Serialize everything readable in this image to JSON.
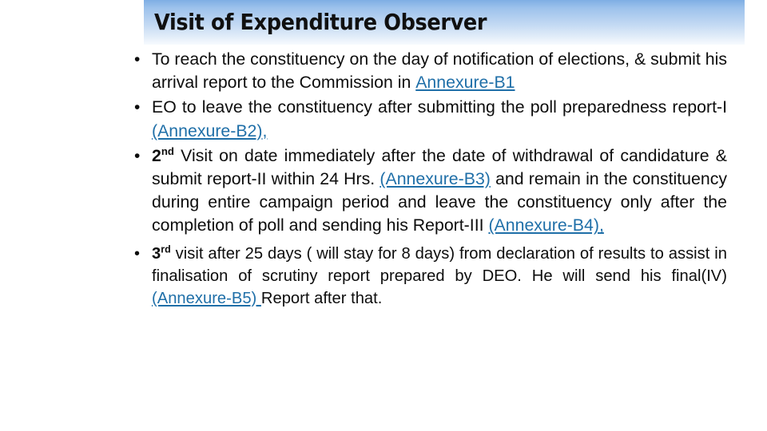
{
  "slide": {
    "title": "Visit of Expenditure Observer",
    "accent_color": "#1F6FA8",
    "title_band_top_color": "#7FAEE4",
    "title_band_bottom_color": "#F7FAFE",
    "text_color": "#0D0D0D",
    "bullet_glyph": "•"
  },
  "bullets": [
    {
      "id": "bullet-1",
      "marker": "•",
      "segments": [
        {
          "kind": "text",
          "value": "To reach the constituency on the day of notification of elections, & submit his arrival report to the Commission in "
        },
        {
          "kind": "link",
          "value": "Annexure-B1"
        }
      ],
      "plain": "To reach the constituency on the day of notification of elections, & submit his arrival report to the Commission in Annexure-B1"
    },
    {
      "id": "bullet-2",
      "marker": "•",
      "segments": [
        {
          "kind": "text",
          "value": "EO to leave the constituency after submitting the poll preparedness report-I "
        },
        {
          "kind": "link",
          "value": "(Annexure-B2),"
        }
      ],
      "plain": "EO to leave the constituency after submitting the poll preparedness report-I (Annexure-B2),"
    },
    {
      "id": "bullet-3",
      "marker": "•",
      "ordinal_number": "2",
      "ordinal_suffix": "nd",
      "segments": [
        {
          "kind": "ordinal",
          "value": "2",
          "suffix": "nd"
        },
        {
          "kind": "text",
          "value": " Visit on date immediately after the date of withdrawal of candidature & submit report-II within 24 Hrs. "
        },
        {
          "kind": "link",
          "value": "(Annexure-B3)"
        },
        {
          "kind": "text",
          "value": " and remain in the constituency during entire campaign period and leave the constituency only after the completion of poll and sending  his Report-III "
        },
        {
          "kind": "link",
          "value": "(Annexure-B4),"
        }
      ],
      "plain": "2nd Visit on date immediately after the date of withdrawal of candidature & submit report-II within 24 Hrs. (Annexure-B3) and remain in the constituency during entire campaign period and leave the constituency only after the completion of poll and sending  his Report-III (Annexure-B4),"
    },
    {
      "id": "bullet-4",
      "marker": "•",
      "ordinal_number": "3",
      "ordinal_suffix": "rd",
      "segments": [
        {
          "kind": "ordinal",
          "value": "3",
          "suffix": "rd"
        },
        {
          "kind": "text",
          "value": " visit after 25 days ( will stay for 8 days)  from declaration of results to assist in finalisation of scrutiny report prepared by DEO. He will send his final(IV) "
        },
        {
          "kind": "link",
          "value": "(Annexure-B5) "
        },
        {
          "kind": "text",
          "value": "Report after that."
        }
      ],
      "plain": "3rd visit after 25 days ( will stay for 8 days)  from declaration of results to assist in finalisation of scrutiny report prepared by DEO. He will send his final(IV) (Annexure-B5) Report after that."
    }
  ],
  "bullet_text": {
    "b1_part1": "To reach the constituency on the day of notification of elections, & submit his arrival report to the Commission in ",
    "b1_link": "Annexure-B1",
    "b2_part1": "EO to leave the constituency after submitting the poll preparedness report-I ",
    "b2_link": "(Annexure-B2),",
    "b3_num": "2",
    "b3_sup": "nd",
    "b3_part1": " Visit on date immediately after the date of withdrawal of candidature & submit report-II within 24 Hrs. ",
    "b3_link1": "(Annexure-B3)",
    "b3_part2": " and remain in the constituency during entire campaign period and leave the constituency only after the completion of poll and sending  his Report-III ",
    "b3_link2": "(Annexure-B4),",
    "b4_num": "3",
    "b4_sup": "rd",
    "b4_part1": " visit after 25 days ( will stay for 8 days)  from declaration of results to assist in finalisation of scrutiny report prepared by DEO. He will send his final(IV) ",
    "b4_link1": "(Annexure-B5) ",
    "b4_part2": "Report after that."
  }
}
